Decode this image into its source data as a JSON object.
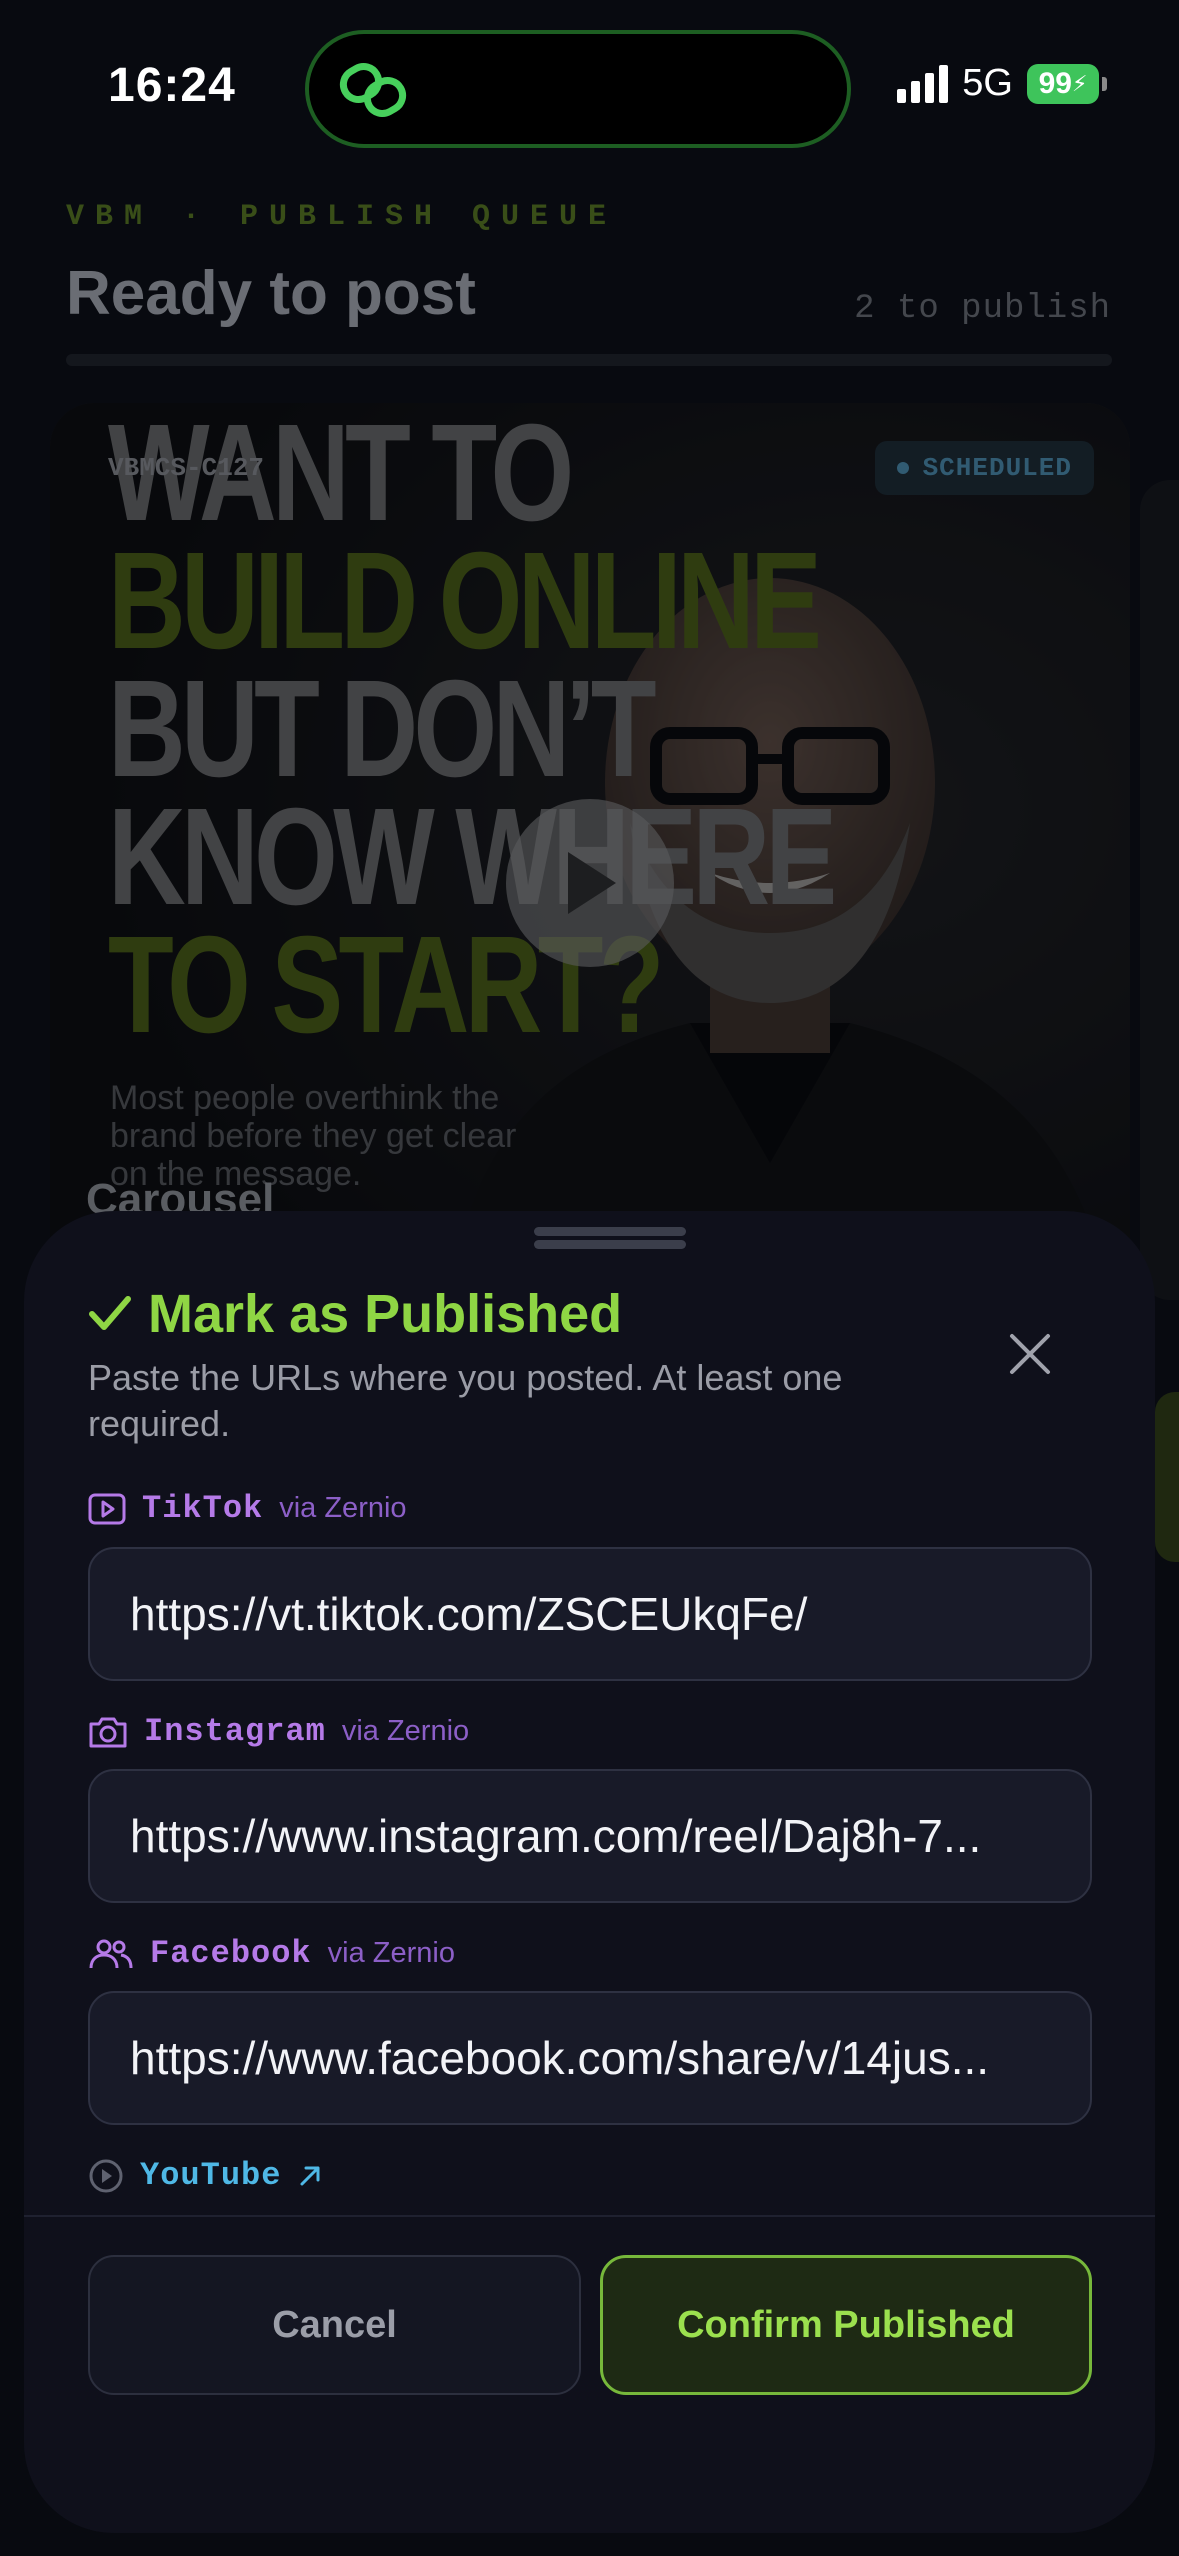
{
  "status_bar": {
    "time": "16:24",
    "network": "5G",
    "battery": "99"
  },
  "header": {
    "eyebrow": "VBM · PUBLISH QUEUE",
    "title": "Ready to post",
    "count": "2 to publish"
  },
  "card": {
    "id": "VBMCS-C127",
    "badge": "SCHEDULED",
    "headline": [
      "WANT TO",
      "BUILD ONLINE",
      "BUT DON’T",
      "KNOW WHERE",
      "TO START?"
    ],
    "caption": "Most people overthink the brand before they get clear on the message.",
    "type": "Carousel"
  },
  "sheet": {
    "title": "Mark as Published",
    "subtitle": "Paste the URLs where you posted. At least one required.",
    "platforms": [
      {
        "name": "TikTok",
        "via": "via Zernio",
        "value": "https://vt.tiktok.com/ZSCEUkqFe/",
        "icon": "play-square-icon"
      },
      {
        "name": "Instagram",
        "via": "via Zernio",
        "value": "https://www.instagram.com/reel/Daj8h-7...",
        "icon": "camera-icon"
      },
      {
        "name": "Facebook",
        "via": "via Zernio",
        "value": "https://www.facebook.com/share/v/14jus...",
        "icon": "users-icon"
      },
      {
        "name": "YouTube",
        "via": "",
        "value": "",
        "icon": "play-circle-icon"
      }
    ],
    "cancel_label": "Cancel",
    "confirm_label": "Confirm Published"
  },
  "colors": {
    "accent_green": "#8fd644",
    "platform_purple": "#b57ae8",
    "youtube_blue": "#4fb8e6",
    "sheet_bg": "#0f101b"
  }
}
